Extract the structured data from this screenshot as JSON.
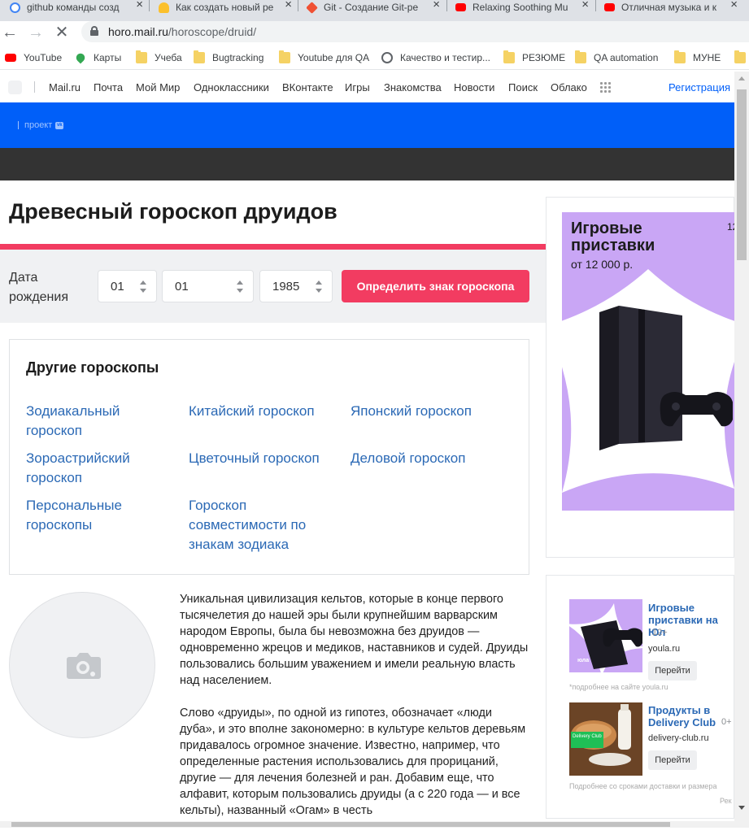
{
  "browser": {
    "tabs": [
      {
        "title": "github команды созд",
        "color": "#4285f4"
      },
      {
        "title": "Как создать новый ре",
        "color": "#fbc02d"
      },
      {
        "title": "Git - Создание Git-ре",
        "color": "#f05033"
      },
      {
        "title": "Relaxing Soothing Mu",
        "color": "#ff0000"
      },
      {
        "title": "Отличная музыка и к",
        "color": "#ff0000"
      }
    ],
    "url_host": "horo.mail.ru",
    "url_path": "/horoscope/druid/",
    "bookmarks": [
      "YouTube",
      "Карты",
      "Учеба",
      "Bugtracking",
      "Youtube для QA",
      "Качество и тестир...",
      "РЕЗЮМЕ",
      "QA automation",
      "МУНЕ"
    ]
  },
  "portal": {
    "links": [
      "Mail.ru",
      "Почта",
      "Мой Мир",
      "Одноклассники",
      "ВКонтакте",
      "Игры",
      "Знакомства",
      "Новости",
      "Поиск",
      "Облако"
    ],
    "register": "Регистрация"
  },
  "header": {
    "project_label": "проект",
    "project_badge": "vk"
  },
  "main": {
    "title": "Древесный гороскоп друидов",
    "form": {
      "label": "Дата рождения",
      "day": "01",
      "month": "01",
      "year": "1985",
      "submit": "Определить знак гороскопа"
    },
    "others": {
      "heading": "Другие гороскопы",
      "links": [
        "Зодиакальный гороскоп",
        "Китайский гороскоп",
        "Японский гороскоп",
        "Зороастрийский гороскоп",
        "Цветочный гороскоп",
        "Деловой гороскоп",
        "Персональные гороскопы",
        "Гороскоп совместимости по знакам зодиака"
      ]
    },
    "article": [
      "Уникальная цивилизация кельтов, которые в конце первого тысячелетия до нашей эры были крупнейшим варварским народом Европы, была бы невозможна без друидов — одновременно жрецов и медиков, наставников и судей. Друиды пользовались большим уважением и имели реальную власть над населением.",
      "Слово «друиды», по одной из гипотез, обозначает «люди дуба», и это вполне закономерно: в культуре кельтов деревьям придавалось огромное значение. Известно, например, что определенные растения использовались для прорицаний, другие — для лечения болезней и ран. Добавим еще, что алфавит, которым пользовались друиды (а с 220 года — и все кельты), названный «Огам» в честь"
    ]
  },
  "ads": {
    "banner": {
      "title": "Игровые приставки",
      "price": "от 12 000 р.",
      "age": "12"
    },
    "items": [
      {
        "title": "Игровые приставки на Юл",
        "age": "12+",
        "site": "youla.ru",
        "button": "Перейти",
        "note": "*подробнее на сайте youla.ru",
        "badge": "юла"
      },
      {
        "title": "Продукты в Delivery Club",
        "age": "0+",
        "site": "delivery-club.ru",
        "button": "Перейти",
        "note": "Подробнее со сроками доставки и размера",
        "badge": "Delivery Club"
      }
    ],
    "footer": "Рек"
  }
}
